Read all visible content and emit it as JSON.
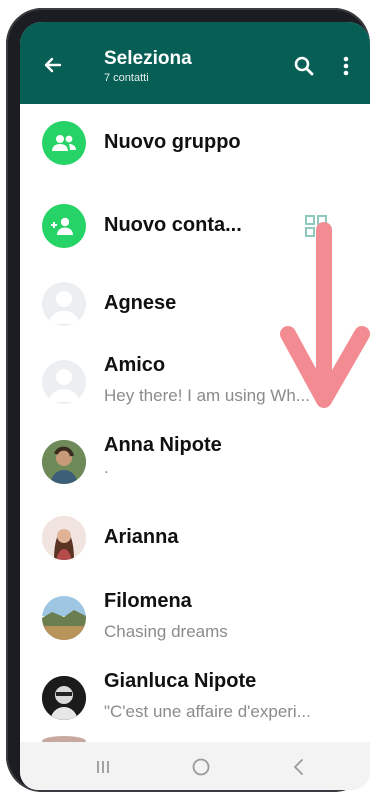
{
  "header": {
    "title": "Seleziona",
    "subtitle": "7 contatti"
  },
  "actions": {
    "new_group": "Nuovo gruppo",
    "new_contact": "Nuovo conta..."
  },
  "contacts": [
    {
      "name": "Agnese",
      "status": ""
    },
    {
      "name": "Amico",
      "status": "Hey there! I am using Wh..."
    },
    {
      "name": "Anna Nipote",
      "status": "."
    },
    {
      "name": "Arianna",
      "status": ""
    },
    {
      "name": "Filomena",
      "status": "Chasing dreams"
    },
    {
      "name": "Gianluca Nipote",
      "status": "\"C'est une affaire d'experi..."
    }
  ],
  "colors": {
    "appbar": "#075e54",
    "accent": "#25d366",
    "overlay_arrow": "#f28c92"
  },
  "icons": {
    "back": "arrow-left",
    "search": "magnifier",
    "more": "three-dots-vertical",
    "qr": "qr-code",
    "nav_recent": "three-bars",
    "nav_home": "circle",
    "nav_back": "chevron-left"
  }
}
